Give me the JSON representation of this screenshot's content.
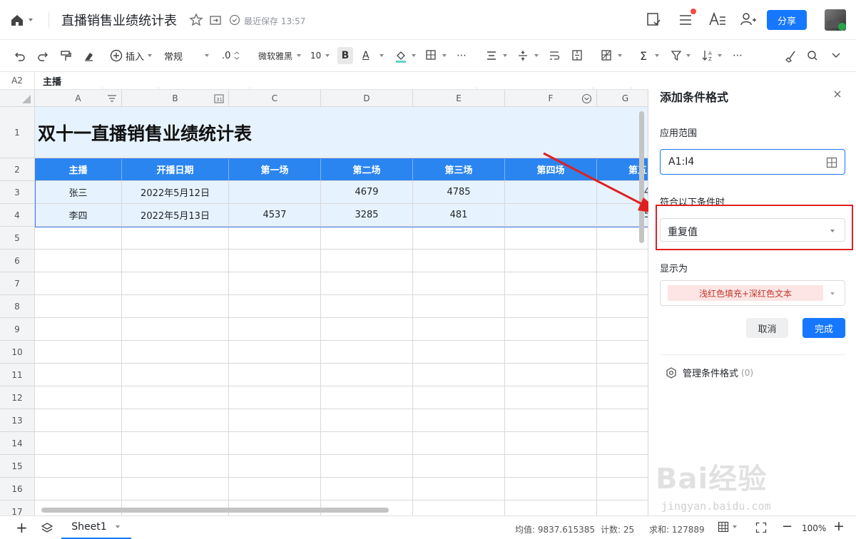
{
  "doc": {
    "title": "直播销售业绩统计表",
    "save_status": "最近保存 13:57"
  },
  "header": {
    "share_label": "分享"
  },
  "toolbar": {
    "insert_label": "插入",
    "format_label": "常规",
    "decimal_label": ".0",
    "font_label": "微软雅黑",
    "fontsize_label": "10",
    "bold_label": "B",
    "font_color_label": "A"
  },
  "formula": {
    "cell_ref": "A2",
    "content": "主播"
  },
  "columns": [
    "A",
    "B",
    "C",
    "D",
    "E",
    "F",
    "G"
  ],
  "rows": [
    "1",
    "2",
    "3",
    "4",
    "5",
    "6",
    "7",
    "8",
    "9",
    "10",
    "11",
    "12",
    "13",
    "14",
    "15",
    "16",
    "17"
  ],
  "sheet": {
    "title": "双十一直播销售业绩统计表",
    "headers": [
      "主播",
      "开播日期",
      "第一场",
      "第二场",
      "第三场",
      "第四场",
      "第五"
    ],
    "data": [
      [
        "张三",
        "2022年5月12日",
        "",
        "4679",
        "4785",
        "",
        "4"
      ],
      [
        "李四",
        "2022年5月13日",
        "4537",
        "3285",
        "481",
        "",
        "5"
      ]
    ]
  },
  "panel": {
    "title": "添加条件格式",
    "range_label": "应用范围",
    "range_value": "A1:I4",
    "condition_label": "符合以下条件时",
    "condition_value": "重复值",
    "display_label": "显示为",
    "display_value": "浅红色填充+深红色文本",
    "cancel_label": "取消",
    "done_label": "完成",
    "manage_label": "管理条件格式",
    "manage_count": "(0)"
  },
  "status": {
    "sheet_tab": "Sheet1",
    "average": "均值: 9837.615385",
    "count": "计数: 25",
    "sum": "求和: 127889",
    "zoom": "100%"
  },
  "watermark": {
    "brand": "Bai经验",
    "url": "jingyan.baidu.com"
  },
  "colors": {
    "accent": "#1677ff",
    "header_fill": "#2b85f0",
    "light_fill": "#e6f2fd",
    "annotation": "#e02020",
    "warning_fill": "#fde5e5",
    "warning_text": "#c0392b"
  }
}
